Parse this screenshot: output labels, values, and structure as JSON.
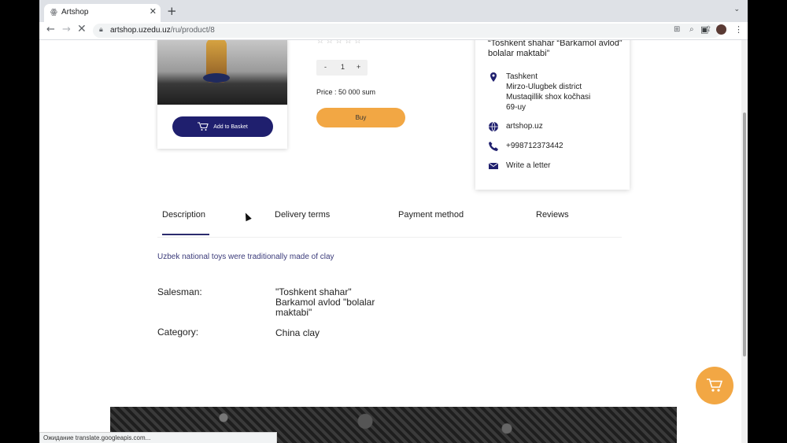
{
  "browser": {
    "tab_title": "Artshop",
    "tab_favicon": "ꙮ",
    "url_host": "artshop.uzedu.uz",
    "url_path": "/ru/product/8",
    "status_text": "Ожидание translate.googleapis.com..."
  },
  "product": {
    "add_to_basket": "Add to Basket",
    "rating_stars": "☆☆☆☆☆",
    "qty_minus": "-",
    "qty_value": "1",
    "qty_plus": "+",
    "price": "Price : 50 000 sum",
    "buy": "Buy"
  },
  "seller": {
    "name": "“Toshkent shahar “Barkamol avlod” bolalar maktabi”",
    "address": [
      "Tashkent",
      "Mirzo-Ulugbek district",
      "Mustaqillik shox kočhasi",
      "69-uy"
    ],
    "website": "artshop.uz",
    "phone": "+998712373442",
    "write": "Write a letter"
  },
  "tabs": [
    {
      "label": "Description"
    },
    {
      "label": "Delivery terms"
    },
    {
      "label": "Payment method"
    },
    {
      "label": "Reviews"
    }
  ],
  "description": "Uzbek national toys were traditionally made of clay",
  "specs": {
    "salesman_label": "Salesman:",
    "salesman_value": "\"Toshkent shahar\" Barkamol avlod \"bolalar maktabi\"",
    "category_label": "Category:",
    "category_value": "China clay"
  },
  "colors": {
    "primary": "#1f1f6e",
    "accent": "#f2a744"
  }
}
